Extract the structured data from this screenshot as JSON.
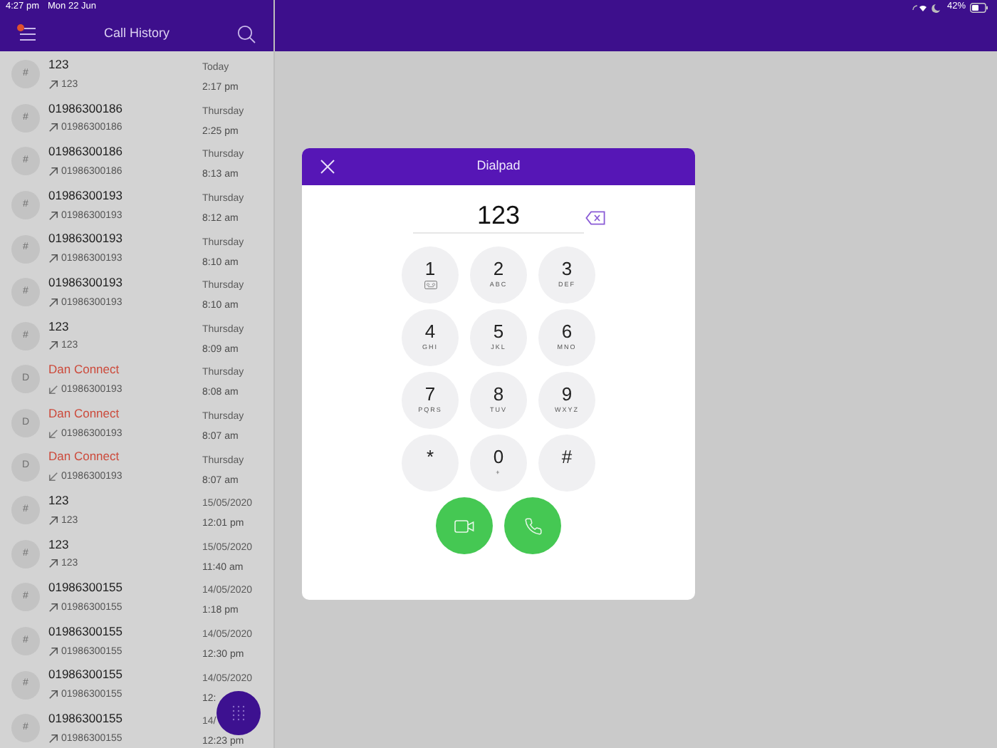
{
  "status_bar": {
    "time": "4:27 pm",
    "date": "Mon 22 Jun",
    "battery": "42%"
  },
  "header": {
    "title": "Call History",
    "menu_badge": true
  },
  "calls": [
    {
      "avatar": "#",
      "name": "123",
      "kind": "outgoing",
      "number": "123",
      "date": "Today",
      "time": "2:17 pm"
    },
    {
      "avatar": "#",
      "name": "01986300186",
      "kind": "outgoing",
      "number": "01986300186",
      "date": "Thursday",
      "time": "2:25 pm"
    },
    {
      "avatar": "#",
      "name": "01986300186",
      "kind": "outgoing",
      "number": "01986300186",
      "date": "Thursday",
      "time": "8:13 am"
    },
    {
      "avatar": "#",
      "name": "01986300193",
      "kind": "outgoing",
      "number": "01986300193",
      "date": "Thursday",
      "time": "8:12 am"
    },
    {
      "avatar": "#",
      "name": "01986300193",
      "kind": "outgoing",
      "number": "01986300193",
      "date": "Thursday",
      "time": "8:10 am"
    },
    {
      "avatar": "#",
      "name": "01986300193",
      "kind": "outgoing",
      "number": "01986300193",
      "date": "Thursday",
      "time": "8:10 am"
    },
    {
      "avatar": "#",
      "name": "123",
      "kind": "outgoing",
      "number": "123",
      "date": "Thursday",
      "time": "8:09 am"
    },
    {
      "avatar": "D",
      "name": "Dan Connect",
      "kind": "missed",
      "number": "01986300193",
      "date": "Thursday",
      "time": "8:08 am"
    },
    {
      "avatar": "D",
      "name": "Dan Connect",
      "kind": "missed",
      "number": "01986300193",
      "date": "Thursday",
      "time": "8:07 am"
    },
    {
      "avatar": "D",
      "name": "Dan Connect",
      "kind": "missed",
      "number": "01986300193",
      "date": "Thursday",
      "time": "8:07 am"
    },
    {
      "avatar": "#",
      "name": "123",
      "kind": "outgoing",
      "number": "123",
      "date": "15/05/2020",
      "time": "12:01 pm"
    },
    {
      "avatar": "#",
      "name": "123",
      "kind": "outgoing",
      "number": "123",
      "date": "15/05/2020",
      "time": "11:40 am"
    },
    {
      "avatar": "#",
      "name": "01986300155",
      "kind": "outgoing",
      "number": "01986300155",
      "date": "14/05/2020",
      "time": "1:18 pm"
    },
    {
      "avatar": "#",
      "name": "01986300155",
      "kind": "outgoing",
      "number": "01986300155",
      "date": "14/05/2020",
      "time": "12:30 pm"
    },
    {
      "avatar": "#",
      "name": "01986300155",
      "kind": "outgoing",
      "number": "01986300155",
      "date": "14/05/2020",
      "time": "12:"
    },
    {
      "avatar": "#",
      "name": "01986300155",
      "kind": "outgoing",
      "number": "01986300155",
      "date": "14/",
      "time": "12:23 pm"
    }
  ],
  "dialpad": {
    "title": "Dialpad",
    "value": "123",
    "keys": [
      {
        "digit": "1",
        "kind": "voicemail"
      },
      {
        "digit": "2",
        "letters": "ABC",
        "kind": "letters"
      },
      {
        "digit": "3",
        "letters": "DEF",
        "kind": "letters"
      },
      {
        "digit": "4",
        "letters": "GHI",
        "kind": "letters"
      },
      {
        "digit": "5",
        "letters": "JKL",
        "kind": "letters"
      },
      {
        "digit": "6",
        "letters": "MNO",
        "kind": "letters"
      },
      {
        "digit": "7",
        "letters": "PQRS",
        "kind": "letters"
      },
      {
        "digit": "8",
        "letters": "TUV",
        "kind": "letters"
      },
      {
        "digit": "9",
        "letters": "WXYZ",
        "kind": "letters"
      },
      {
        "digit": "*",
        "kind": "symbol"
      },
      {
        "digit": "0",
        "letters": "+",
        "kind": "letters"
      },
      {
        "digit": "#",
        "kind": "symbol"
      }
    ]
  }
}
